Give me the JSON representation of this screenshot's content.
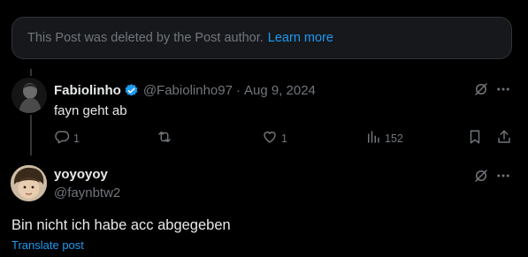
{
  "deleted_notice": {
    "text": "This Post was deleted by the Post author.",
    "link": "Learn more"
  },
  "reply": {
    "name": "Fabiolinho",
    "handle": "@Fabiolinho97",
    "separator": "·",
    "date": "Aug 9, 2024",
    "text": "fayn geht ab",
    "replies": "1",
    "reposts": "",
    "likes": "1",
    "views": "152"
  },
  "main_post": {
    "name": "yoyoyoy",
    "handle": "@faynbtw2",
    "text": "Bin nicht ich habe acc abgegeben",
    "translate": "Translate post"
  },
  "colors": {
    "accent": "#1d9bf0",
    "muted": "#71767b",
    "text": "#e7e9ea",
    "background": "#000000"
  },
  "icons": [
    "verified-badge-icon",
    "grok-icon",
    "more-icon",
    "reply-icon",
    "repost-icon",
    "like-icon",
    "views-icon",
    "bookmark-icon",
    "share-icon"
  ]
}
